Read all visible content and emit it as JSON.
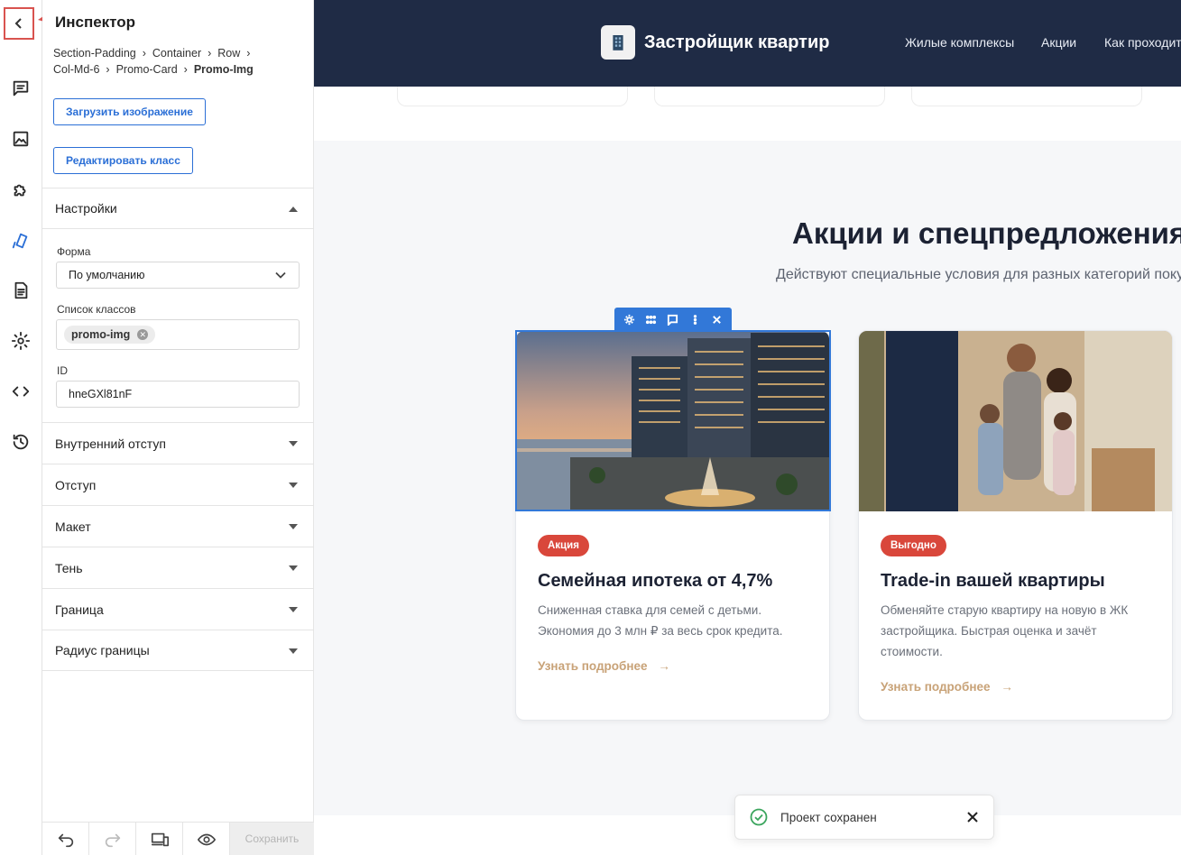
{
  "inspector": {
    "title": "Инспектор",
    "breadcrumb": [
      "Section-Padding",
      "Container",
      "Row",
      "Col-Md-6",
      "Promo-Card",
      "Promo-Img"
    ],
    "upload_label": "Загрузить изображение",
    "edit_class_label": "Редактировать класс",
    "settings_label": "Настройки",
    "shape_label": "Форма",
    "shape_value": "По умолчанию",
    "classes_label": "Список классов",
    "class_chip": "promo-img",
    "id_label": "ID",
    "id_value": "hneGXl81nF",
    "sections": [
      "Внутренний отступ",
      "Отступ",
      "Макет",
      "Тень",
      "Граница",
      "Радиус границы"
    ],
    "save_label": "Сохранить"
  },
  "rail": {
    "icons": [
      "chevron-left-icon",
      "comment-icon",
      "image-icon",
      "puzzle-icon",
      "brush-icon",
      "document-icon",
      "gear-icon",
      "code-icon",
      "history-icon"
    ],
    "active_color": "#2b6fd6"
  },
  "site": {
    "brand": "Застройщик квартир",
    "nav": [
      "Жилые комплексы",
      "Акции",
      "Как проходит"
    ],
    "header_color": "#1f2b45",
    "section_title": "Акции и спецпредложения",
    "section_subtitle": "Действуют специальные условия для разных категорий покупателей",
    "cards": [
      {
        "badge": "Акция",
        "title": "Семейная ипотека от 4,7%",
        "text": "Сниженная ставка для семей с детьми. Экономия до 3 млн ₽ за весь срок кредита.",
        "link": "Узнать подробнее"
      },
      {
        "badge": "Выгодно",
        "title": "Trade-in вашей квартиры",
        "text": "Обменяйте старую квартиру на новую в ЖК застройщика. Быстрая оценка и зачёт стоимости.",
        "link": "Узнать подробнее"
      }
    ],
    "badge_color": "#d9473b",
    "link_color": "#c8a277"
  },
  "toast": {
    "text": "Проект сохранен"
  }
}
